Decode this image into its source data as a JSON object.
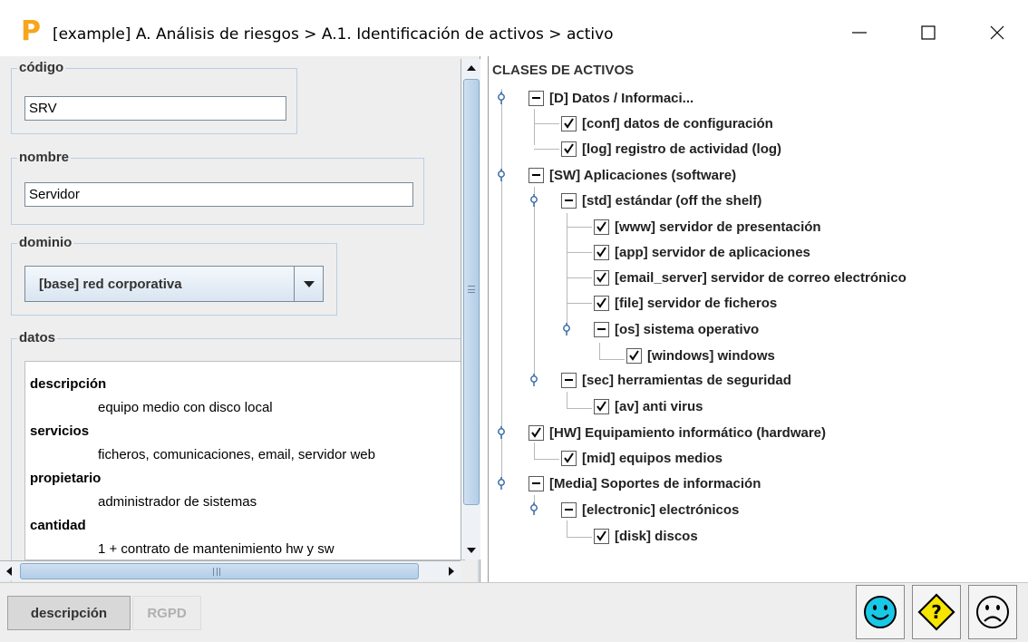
{
  "window": {
    "title": "[example] A. Análisis de riesgos > A.1. Identificación de activos > activo",
    "logo_letter": "P",
    "controls": [
      "minimize",
      "maximize",
      "close"
    ]
  },
  "form": {
    "codigo": {
      "label": "código",
      "value": "SRV"
    },
    "nombre": {
      "label": "nombre",
      "value": "Servidor"
    },
    "dominio": {
      "label": "dominio",
      "selected": "[base] red corporativa"
    },
    "datos": {
      "label": "datos",
      "entries": [
        {
          "key": "descripción",
          "value": "equipo medio con disco local"
        },
        {
          "key": "servicios",
          "value": "ficheros, comunicaciones, email, servidor web"
        },
        {
          "key": "propietario",
          "value": "administrador de sistemas"
        },
        {
          "key": "cantidad",
          "value": "1 + contrato de mantenimiento hw y sw"
        }
      ]
    }
  },
  "tree": {
    "title": "CLASES DE ACTIVOS",
    "nodes": [
      {
        "label": "[D] Datos / Informaci...",
        "state": "minus"
      },
      {
        "label": "[conf] datos de configuración",
        "state": "checked"
      },
      {
        "label": "[log] registro de actividad (log)",
        "state": "checked"
      },
      {
        "label": "[SW] Aplicaciones (software)",
        "state": "minus"
      },
      {
        "label": "[std] estándar (off the shelf)",
        "state": "minus"
      },
      {
        "label": "[www] servidor de presentación",
        "state": "checked"
      },
      {
        "label": "[app] servidor de aplicaciones",
        "state": "checked"
      },
      {
        "label": "[email_server] servidor de correo electrónico",
        "state": "checked"
      },
      {
        "label": "[file] servidor de ficheros",
        "state": "checked"
      },
      {
        "label": "[os] sistema operativo",
        "state": "minus"
      },
      {
        "label": "[windows] windows",
        "state": "checked"
      },
      {
        "label": "[sec] herramientas de seguridad",
        "state": "minus"
      },
      {
        "label": "[av] anti virus",
        "state": "checked"
      },
      {
        "label": "[HW] Equipamiento informático (hardware)",
        "state": "checked"
      },
      {
        "label": "[mid] equipos medios",
        "state": "checked"
      },
      {
        "label": "[Media] Soportes de información",
        "state": "minus"
      },
      {
        "label": "[electronic] electrónicos",
        "state": "minus"
      },
      {
        "label": "[disk] discos",
        "state": "checked"
      }
    ]
  },
  "bottom": {
    "tabs": [
      {
        "label": "descripción",
        "active": true
      },
      {
        "label": "RGPD",
        "active": false
      }
    ],
    "actions": [
      "happy-face-icon",
      "help-diamond-icon",
      "sad-face-icon"
    ]
  },
  "colors": {
    "panel_bg": "#eeeeee",
    "fieldset_border": "#b8cfe5",
    "scroll_thumb": "#b3cde7",
    "logo_orange": "#f7a51d",
    "happy_face": "#19c7e6",
    "help_diamond": "#f7e400"
  }
}
